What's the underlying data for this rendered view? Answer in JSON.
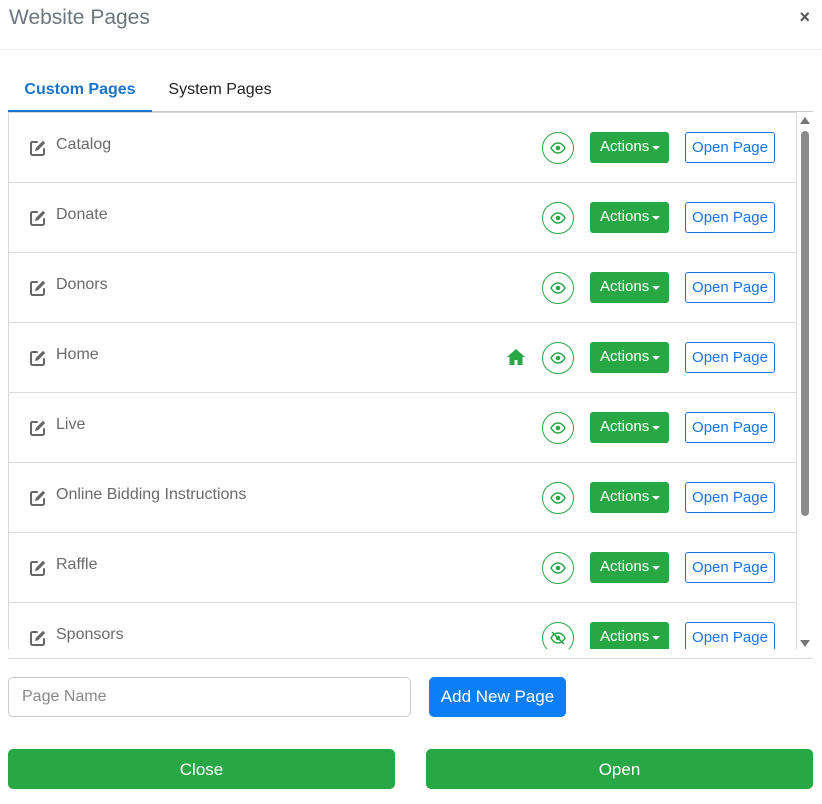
{
  "header": {
    "title": "Website Pages",
    "close_glyph": "×"
  },
  "tabs": [
    {
      "label": "Custom Pages",
      "active": true
    },
    {
      "label": "System Pages",
      "active": false
    }
  ],
  "pages": [
    {
      "name": "Catalog",
      "visible": true,
      "home": false
    },
    {
      "name": "Donate",
      "visible": true,
      "home": false
    },
    {
      "name": "Donors",
      "visible": true,
      "home": false
    },
    {
      "name": "Home",
      "visible": true,
      "home": true
    },
    {
      "name": "Live",
      "visible": true,
      "home": false
    },
    {
      "name": "Online Bidding Instructions",
      "visible": true,
      "home": false
    },
    {
      "name": "Raffle",
      "visible": true,
      "home": false
    },
    {
      "name": "Sponsors",
      "visible": false,
      "home": false
    }
  ],
  "row_buttons": {
    "actions_label": "Actions",
    "open_label": "Open Page"
  },
  "new_page": {
    "placeholder": "Page Name",
    "value": "",
    "add_label": "Add New Page"
  },
  "footer": {
    "close_label": "Close",
    "open_label": "Open"
  },
  "colors": {
    "green": "#28a745",
    "blue": "#1a73e8",
    "tab_active": "#1a73c9"
  },
  "icons": {
    "edit": "edit-icon",
    "eye": "eye-icon",
    "eye_off": "eye-slash-icon",
    "home": "home-icon"
  }
}
